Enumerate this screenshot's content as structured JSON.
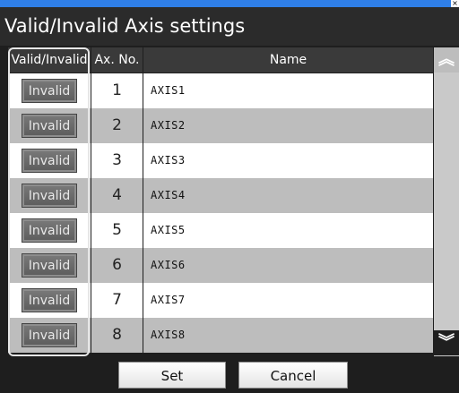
{
  "window": {
    "title": "Valid/Invalid Axis settings",
    "close_label": "×"
  },
  "table": {
    "headers": {
      "valid": "Valid/Invalid",
      "axis_no": "Ax. No.",
      "name": "Name"
    },
    "rows": [
      {
        "state": "Invalid",
        "no": "1",
        "name": "AXIS1"
      },
      {
        "state": "Invalid",
        "no": "2",
        "name": "AXIS2"
      },
      {
        "state": "Invalid",
        "no": "3",
        "name": "AXIS3"
      },
      {
        "state": "Invalid",
        "no": "4",
        "name": "AXIS4"
      },
      {
        "state": "Invalid",
        "no": "5",
        "name": "AXIS5"
      },
      {
        "state": "Invalid",
        "no": "6",
        "name": "AXIS6"
      },
      {
        "state": "Invalid",
        "no": "7",
        "name": "AXIS7"
      },
      {
        "state": "Invalid",
        "no": "8",
        "name": "AXIS8"
      }
    ]
  },
  "scrollbar": {
    "up_icon": "double-chevron-up-icon",
    "down_icon": "double-chevron-down-icon"
  },
  "actions": {
    "set_label": "Set",
    "cancel_label": "Cancel"
  },
  "colors": {
    "row_light": "#ffffff",
    "row_dark": "#bdbdbd",
    "accent": "#2f7fe8"
  }
}
